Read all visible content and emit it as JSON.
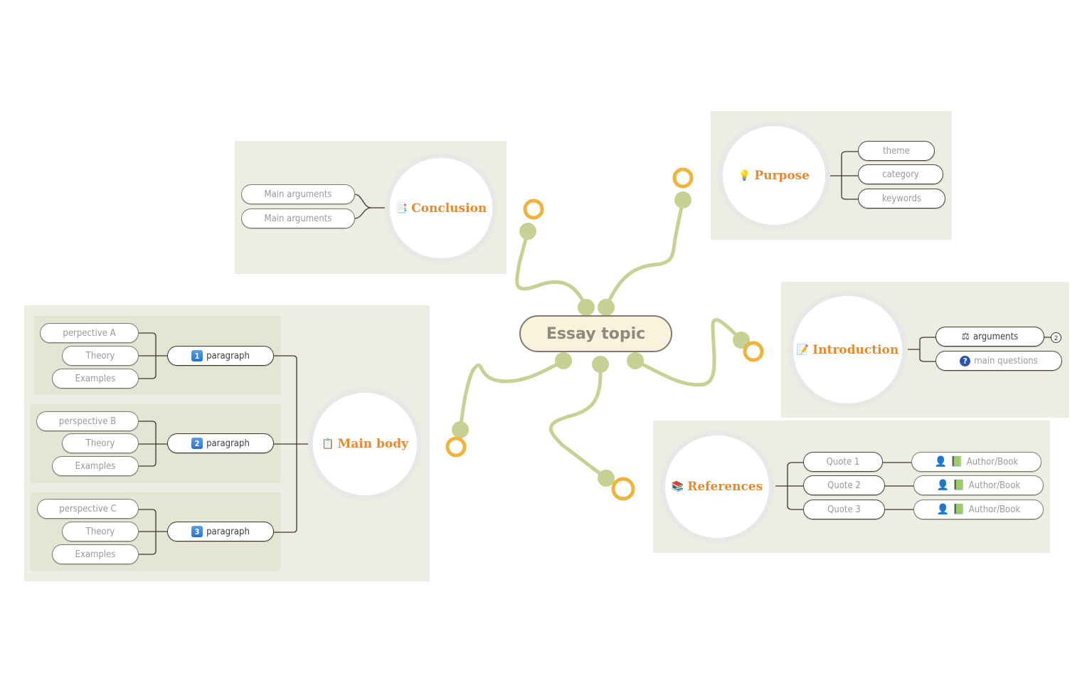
{
  "central_topic": {
    "label": "Essay topic"
  },
  "colors": {
    "accent": "#e8892e",
    "branch": "#c5d293",
    "knob_ring": "#f0b43a",
    "panel": "#eeede3",
    "subpanel": "#e4e5d3",
    "topic_fill": "#faf2dc"
  },
  "conclusion": {
    "label": "Conclusion",
    "icon": "document-icon",
    "children": [
      "Main arguments",
      "Main arguments"
    ]
  },
  "purpose": {
    "label": "Purpose",
    "icon": "lightbulb-icon",
    "children": [
      "theme",
      "category",
      "keywords"
    ]
  },
  "introduction": {
    "label": "Introduction",
    "icon": "notepad-pencil-icon",
    "children": [
      {
        "label": "arguments",
        "icon": "gavel-icon",
        "badge": "2"
      },
      {
        "label": "main questions",
        "icon": "question-icon"
      }
    ]
  },
  "references": {
    "label": "References",
    "icon": "books-icon",
    "quotes": [
      {
        "label": "Quote 1",
        "source": "Author/Book"
      },
      {
        "label": "Quote 2",
        "source": "Author/Book"
      },
      {
        "label": "Quote 3",
        "source": "Author/Book"
      }
    ]
  },
  "main_body": {
    "label": "Main body",
    "icon": "clipboard-icon",
    "paragraphs": [
      {
        "number": "1",
        "label": "paragraph",
        "children": [
          "perpective A",
          "Theory",
          "Examples"
        ]
      },
      {
        "number": "2",
        "label": "paragraph",
        "children": [
          "perspective B",
          "Theory",
          "Examples"
        ]
      },
      {
        "number": "3",
        "label": "paragraph",
        "children": [
          "perspective C",
          "Theory",
          "Examples"
        ]
      }
    ]
  }
}
